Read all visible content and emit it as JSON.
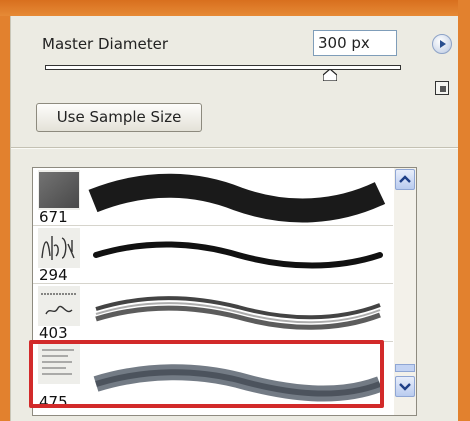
{
  "panel": {
    "diameter_label": "Master Diameter",
    "diameter_value": "300 px",
    "diameter_slider_fraction": 0.8,
    "use_sample_size_label": "Use Sample Size"
  },
  "brushes": [
    {
      "number": "671",
      "thumb_text": ""
    },
    {
      "number": "294",
      "thumb_text": ""
    },
    {
      "number": "403",
      "thumb_text": ""
    },
    {
      "number": "475",
      "thumb_text": ""
    }
  ],
  "icons": {
    "flyout_menu": "flyout-menu-icon",
    "new_preset": "new-preset-icon",
    "scroll_up": "up-arrow-icon",
    "scroll_down": "down-arrow-icon"
  },
  "colors": {
    "highlight": "#d22a2a",
    "background": "#e2812e",
    "panel": "#ecebe3"
  }
}
